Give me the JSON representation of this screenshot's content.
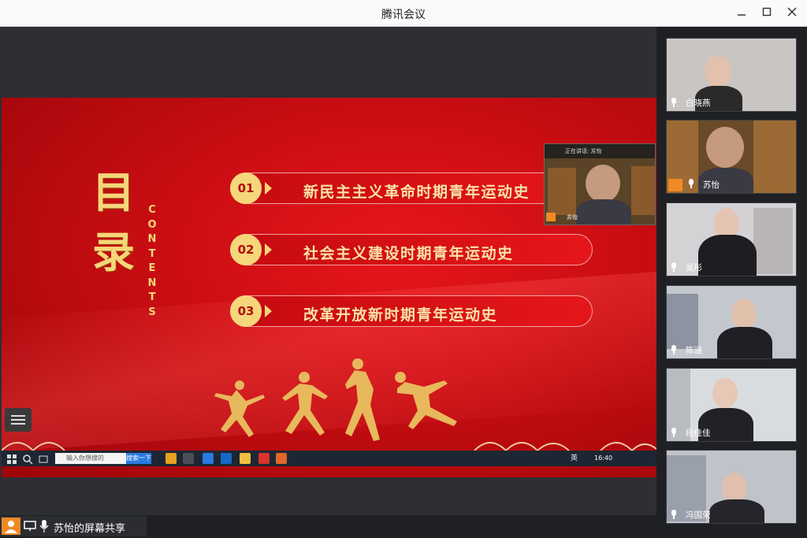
{
  "window": {
    "title": "腾讯会议"
  },
  "slide": {
    "title_chars": [
      "目",
      "录"
    ],
    "contents_label": "CONTENTS",
    "items": [
      {
        "num": "01",
        "text": "新民主主义革命时期青年运动史"
      },
      {
        "num": "02",
        "text": "社会主义建设时期青年运动史"
      },
      {
        "num": "03",
        "text": "改革开放新时期青年运动史"
      }
    ]
  },
  "shared_taskbar": {
    "search_placeholder": "输入你想搜的",
    "search_button": "搜索一下",
    "tray_text": "英",
    "clock": "16:40"
  },
  "pip": {
    "speaking_label": "正在讲话: 苏怡",
    "name": "苏怡"
  },
  "participants": [
    {
      "name": "白晓燕"
    },
    {
      "name": "苏怡"
    },
    {
      "name": "吴彤"
    },
    {
      "name": "陈涵"
    },
    {
      "name": "段佳佳"
    },
    {
      "name": "冯国荣"
    }
  ],
  "status": {
    "share_text": "苏怡的屏幕共享"
  },
  "colors": {
    "slide_red": "#d90f15",
    "gold": "#f6d67a",
    "host_orange": "#f08a24"
  }
}
